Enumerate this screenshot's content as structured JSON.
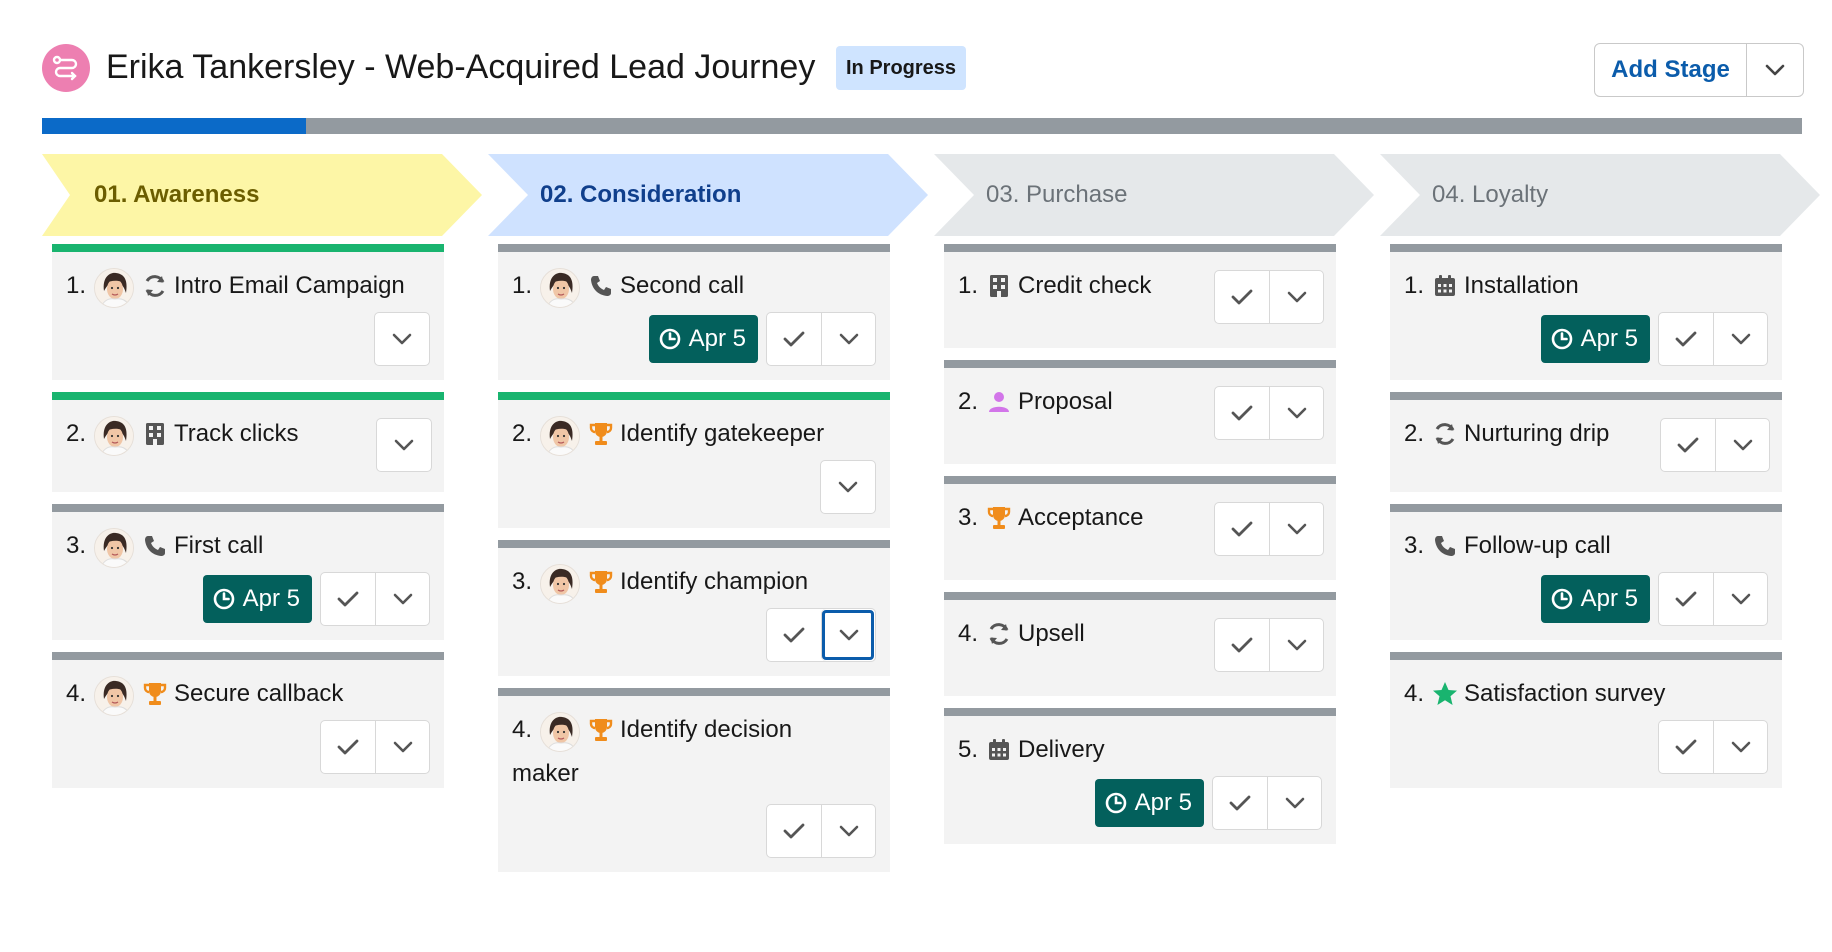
{
  "header": {
    "title": "Erika Tankersley - Web-Acquired Lead Journey",
    "status": "In Progress",
    "add_stage_label": "Add Stage"
  },
  "progress": {
    "completed_fraction": 0.15
  },
  "colors": {
    "awareness_fill": "#fdf6a6",
    "awareness_text": "#6b5d00",
    "consideration_fill": "#cfe2ff",
    "consideration_text": "#103f8c",
    "inactive_fill": "#e5e8ea",
    "inactive_text": "#6b7278",
    "due_badge": "#03605c",
    "accent_blue": "#0b5cab"
  },
  "stages": [
    {
      "label": "01. Awareness",
      "tasks": [
        {
          "num": "1.",
          "icon": "refresh-icon",
          "label": "Intro Email Campaign",
          "due": "",
          "bar": "green"
        },
        {
          "num": "2.",
          "icon": "building-icon",
          "label": "Track clicks",
          "due": "",
          "bar": "green"
        },
        {
          "num": "3.",
          "icon": "phone-icon",
          "label": "First call",
          "due": "Apr 5",
          "bar": "gray"
        },
        {
          "num": "4.",
          "icon": "trophy-icon",
          "label": "Secure callback",
          "due": "",
          "bar": "gray"
        }
      ]
    },
    {
      "label": "02. Consideration",
      "tasks": [
        {
          "num": "1.",
          "icon": "phone-icon",
          "label": "Second call",
          "due": "Apr 5",
          "bar": "gray"
        },
        {
          "num": "2.",
          "icon": "trophy-icon",
          "label": "Identify gatekeeper",
          "due": "",
          "bar": "green"
        },
        {
          "num": "3.",
          "icon": "trophy-icon",
          "label": "Identify champion",
          "due": "",
          "bar": "gray"
        },
        {
          "num": "4.",
          "icon": "trophy-icon",
          "label": "Identify decision maker",
          "label_line1": "Identify decision",
          "label_line2": "maker",
          "due": "",
          "bar": "gray"
        }
      ]
    },
    {
      "label": "03. Purchase",
      "tasks": [
        {
          "num": "1.",
          "icon": "building-icon",
          "label": "Credit check",
          "due": "",
          "bar": "gray"
        },
        {
          "num": "2.",
          "icon": "person-icon",
          "label": "Proposal",
          "due": "",
          "bar": "gray"
        },
        {
          "num": "3.",
          "icon": "trophy-icon",
          "label": "Acceptance",
          "due": "",
          "bar": "gray"
        },
        {
          "num": "4.",
          "icon": "refresh-icon",
          "label": "Upsell",
          "due": "",
          "bar": "gray"
        },
        {
          "num": "5.",
          "icon": "calendar-icon",
          "label": "Delivery",
          "due": "Apr 5",
          "bar": "gray"
        }
      ]
    },
    {
      "label": "04. Loyalty",
      "tasks": [
        {
          "num": "1.",
          "icon": "calendar-icon",
          "label": "Installation",
          "due": "Apr 5",
          "bar": "gray"
        },
        {
          "num": "2.",
          "icon": "refresh-icon",
          "label": "Nurturing drip",
          "due": "",
          "bar": "gray"
        },
        {
          "num": "3.",
          "icon": "phone-icon",
          "label": "Follow-up call",
          "due": "Apr 5",
          "bar": "gray"
        },
        {
          "num": "4.",
          "icon": "star-icon",
          "label": "Satisfaction survey",
          "due": "",
          "bar": "gray"
        }
      ]
    }
  ]
}
